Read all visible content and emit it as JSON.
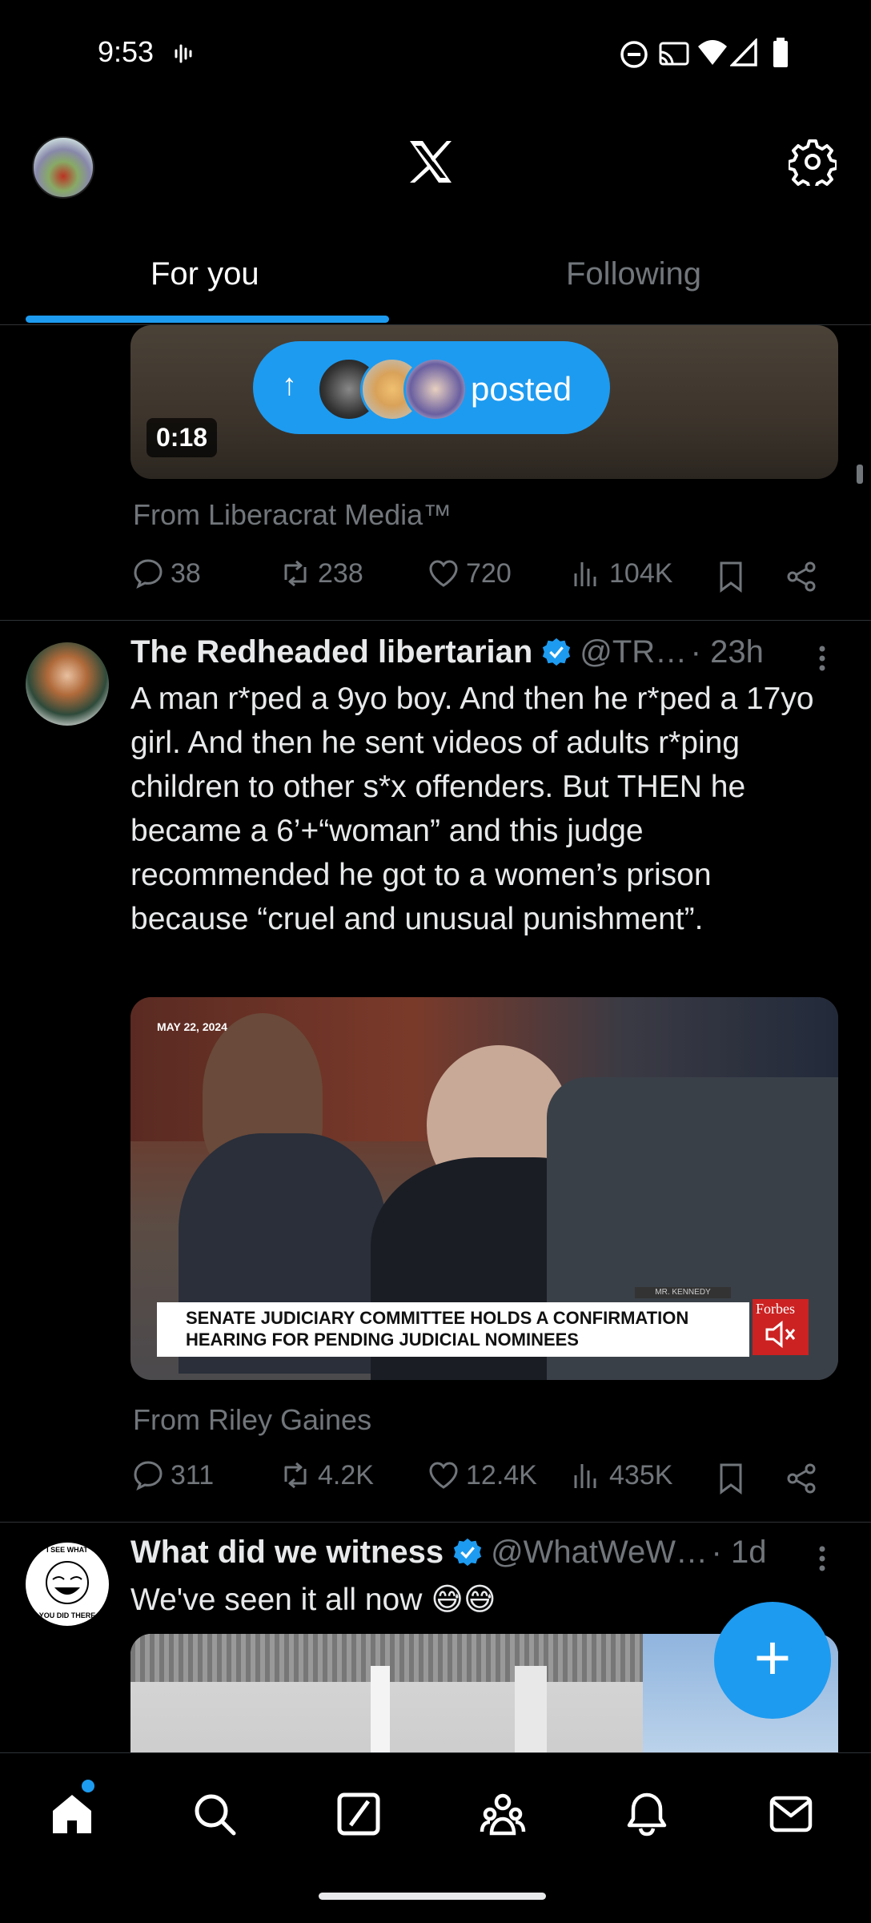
{
  "status": {
    "time": "9:53"
  },
  "header": {
    "logo": "X"
  },
  "tabs": [
    {
      "label": "For you"
    },
    {
      "label": "Following"
    }
  ],
  "posted_banner": {
    "label": "posted"
  },
  "post1": {
    "duration": "0:18",
    "from": "From Liberacrat Media™",
    "stats": {
      "replies": "38",
      "reposts": "238",
      "likes": "720",
      "views": "104K"
    }
  },
  "post2": {
    "name": "The Redheaded libertarian",
    "handle": "@TR…",
    "time": "· 23h",
    "text": "A man r*ped a 9yo boy. And then he r*ped a 17yo girl. And then he sent videos of adults r*ping children to other s*x offenders. But THEN he became a 6’+“woman” and this judge recommended he got to a women’s prison because “cruel and unusual punishment”.",
    "media": {
      "date": "MAY 22, 2024",
      "chyron_line1": "SENATE JUDICIARY COMMITTEE HOLDS A CONFIRMATION",
      "chyron_line2": "HEARING FOR PENDING JUDICIAL NOMINEES",
      "brand": "Forbes",
      "nameplate": "MR. KENNEDY"
    },
    "from": "From Riley Gaines",
    "stats": {
      "replies": "311",
      "reposts": "4.2K",
      "likes": "12.4K",
      "views": "435K"
    }
  },
  "post3": {
    "name": "What did we witness",
    "handle": "@WhatWeW…",
    "time": "· 1d",
    "text": "We've seen it all now 😅😅",
    "avatar_text_top": "I SEE WHAT",
    "avatar_text_bottom": "YOU DID THERE"
  },
  "fab": {
    "label": "+"
  },
  "colors": {
    "accent": "#1d9bf0",
    "background": "#000000",
    "muted": "#71767b",
    "text": "#e7e9ea"
  },
  "icons": [
    "signal-waves-icon",
    "dnd-icon",
    "cast-icon",
    "wifi-icon",
    "cell-signal-icon",
    "battery-icon",
    "x-logo-icon",
    "gear-icon",
    "reply-icon",
    "repost-icon",
    "like-icon",
    "views-icon",
    "bookmark-icon",
    "share-icon",
    "verified-icon",
    "more-icon",
    "home-icon",
    "search-icon",
    "grok-icon",
    "communities-icon",
    "notifications-icon",
    "messages-icon"
  ]
}
